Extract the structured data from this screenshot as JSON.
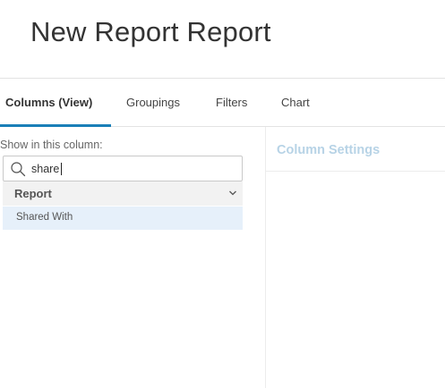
{
  "header": {
    "title": "New Report Report"
  },
  "tabs": [
    {
      "label": "Columns (View)",
      "active": true
    },
    {
      "label": "Groupings",
      "active": false
    },
    {
      "label": "Filters",
      "active": false
    },
    {
      "label": "Chart",
      "active": false
    }
  ],
  "columns_panel": {
    "show_label": "Show in this column:",
    "search": {
      "value": "share",
      "icon": "search-icon"
    },
    "group": {
      "label": "Report",
      "icon": "chevron-down-icon"
    },
    "items": [
      {
        "label": "Shared With"
      }
    ]
  },
  "settings_panel": {
    "title": "Column Settings"
  },
  "colors": {
    "accent": "#1a7fb8",
    "selected_row": "#e6f0fa",
    "settings_title": "#b7d3e6"
  }
}
